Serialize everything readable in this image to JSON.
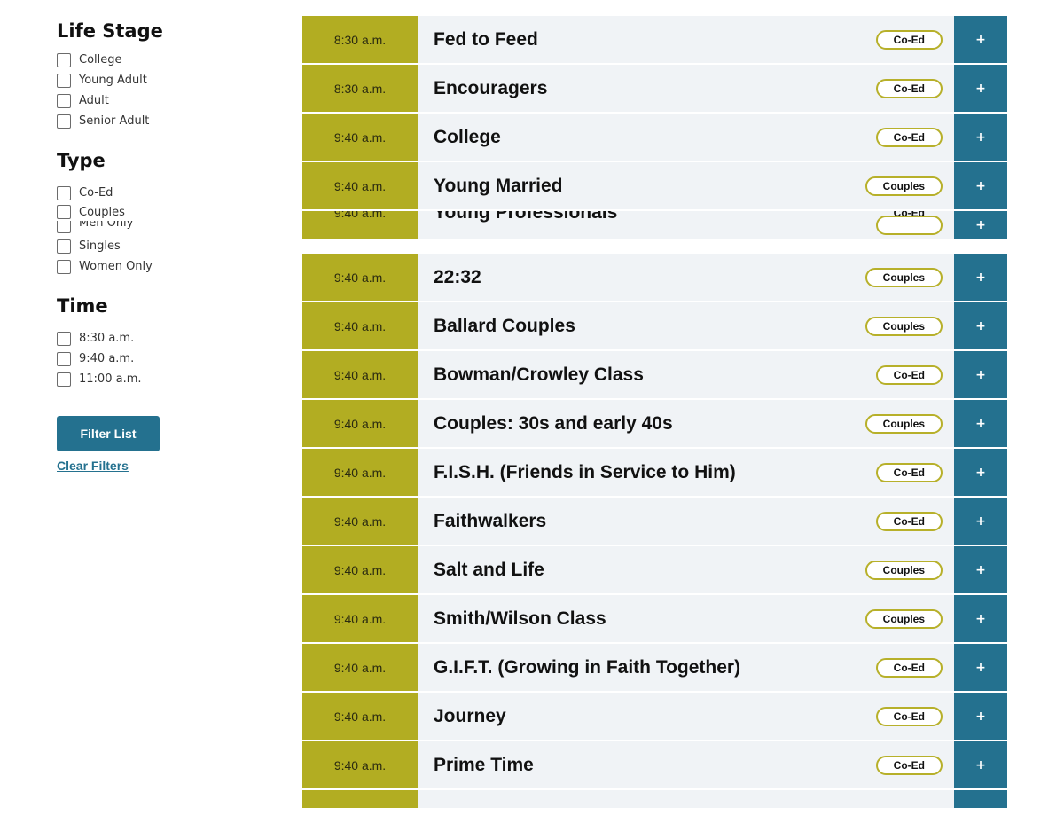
{
  "filters": {
    "life_stage": {
      "title": "Life Stage",
      "options": [
        "College",
        "Young Adult",
        "Adult",
        "Senior Adult"
      ]
    },
    "type": {
      "title": "Type",
      "options": [
        "Co-Ed",
        "Couples",
        "Men Only",
        "Singles",
        "Women Only"
      ]
    },
    "time": {
      "title": "Time",
      "options": [
        "8:30 a.m.",
        "9:40 a.m.",
        "11:00 a.m."
      ]
    },
    "filter_button": "Filter List",
    "clear_link": "Clear Filters"
  },
  "classes": [
    {
      "time": "8:30 a.m.",
      "name": "Fed to Feed",
      "type": "Co-Ed",
      "action": "+"
    },
    {
      "time": "8:30 a.m.",
      "name": "Encouragers",
      "type": "Co-Ed",
      "action": "+"
    },
    {
      "time": "9:40 a.m.",
      "name": "College",
      "type": "Co-Ed",
      "action": "+"
    },
    {
      "time": "9:40 a.m.",
      "name": "Young Married",
      "type": "Couples",
      "action": "+"
    },
    {
      "time": "9:40 a.m.",
      "name": "Young Professionals",
      "type": "Co-Ed",
      "action": "+"
    },
    {
      "time": "9:40 a.m.",
      "name": "22:32",
      "type": "Couples",
      "action": "+"
    },
    {
      "time": "9:40 a.m.",
      "name": "Ballard Couples",
      "type": "Couples",
      "action": "+"
    },
    {
      "time": "9:40 a.m.",
      "name": "Bowman/Crowley Class",
      "type": "Co-Ed",
      "action": "+"
    },
    {
      "time": "9:40 a.m.",
      "name": "Couples: 30s and early 40s",
      "type": "Couples",
      "action": "+"
    },
    {
      "time": "9:40 a.m.",
      "name": "F.I.S.H. (Friends in Service to Him)",
      "type": "Co-Ed",
      "action": "+"
    },
    {
      "time": "9:40 a.m.",
      "name": "Faithwalkers",
      "type": "Co-Ed",
      "action": "+"
    },
    {
      "time": "9:40 a.m.",
      "name": "Salt and Life",
      "type": "Couples",
      "action": "+"
    },
    {
      "time": "9:40 a.m.",
      "name": "Smith/Wilson Class",
      "type": "Couples",
      "action": "+"
    },
    {
      "time": "9:40 a.m.",
      "name": "G.I.F.T. (Growing in Faith Together)",
      "type": "Co-Ed",
      "action": "+"
    },
    {
      "time": "9:40 a.m.",
      "name": "Journey",
      "type": "Co-Ed",
      "action": "+"
    },
    {
      "time": "9:40 a.m.",
      "name": "Prime Time",
      "type": "Co-Ed",
      "action": "+"
    }
  ],
  "colors": {
    "time_bg": "#b2ad22",
    "action_bg": "#24718f",
    "row_bg": "#f0f3f6",
    "badge_border": "#b7b02a"
  }
}
